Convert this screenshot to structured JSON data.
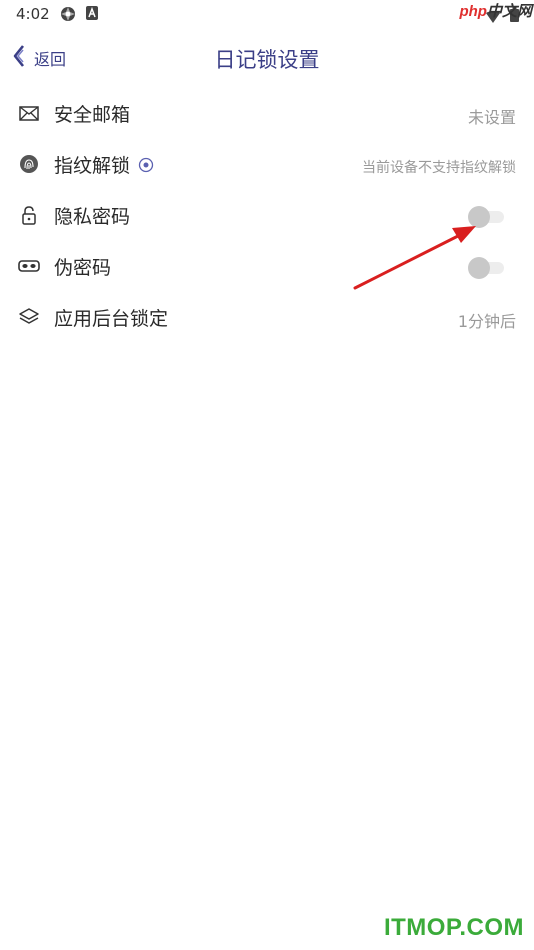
{
  "status_bar": {
    "time": "4:02",
    "icons": [
      "settings-flower-icon",
      "app-badge-icon",
      "wifi-icon",
      "battery-icon"
    ]
  },
  "watermark_top": {
    "brand": "php",
    "text": "中文网"
  },
  "nav": {
    "back_label": "返回",
    "title": "日记锁设置",
    "accent_color": "#3b3f87"
  },
  "settings": [
    {
      "label": "安全邮箱",
      "value": "未设置",
      "icon": "mail-icon"
    },
    {
      "label": "指纹解锁",
      "value": "当前设备不支持指纹解锁",
      "icon": "fingerprint-icon",
      "help_icon": "help-circle-icon"
    },
    {
      "label": "隐私密码",
      "toggle": false,
      "icon": "lock-icon"
    },
    {
      "label": "伪密码",
      "toggle": false,
      "icon": "mask-icon"
    },
    {
      "label": "应用后台锁定",
      "value": "1分钟后",
      "icon": "layers-icon"
    }
  ],
  "annotation": {
    "arrow_color": "#d91f1f"
  },
  "watermark_bottom": {
    "text": "ITMOP.COM",
    "color": "#3bab3a"
  }
}
